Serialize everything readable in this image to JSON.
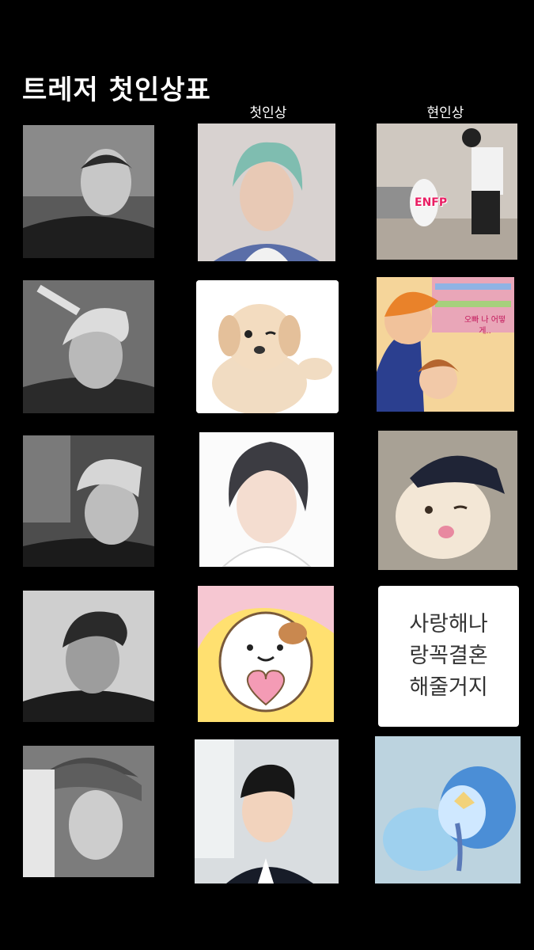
{
  "title": "트레저 첫인상표",
  "columns": [
    "",
    "첫인상",
    "현인상"
  ],
  "rows": [
    {
      "member": "monochrome-portrait-1",
      "first": "teal-hair-portrait",
      "current": "dog-and-person-photo",
      "current_caption": "ENFP"
    },
    {
      "member": "monochrome-portrait-2",
      "first": "puppy-photo",
      "current": "anime-couple-illustration",
      "current_caption": "오빠 나 어떻게.."
    },
    {
      "member": "monochrome-portrait-3",
      "first": "anime-boy-illustration",
      "current": "cat-in-cap-photo"
    },
    {
      "member": "monochrome-portrait-4",
      "first": "hamster-heart-illustration",
      "current_text": [
        "사랑해나",
        "랑꼭결혼",
        "해줄거지"
      ]
    },
    {
      "member": "monochrome-portrait-5",
      "first": "suit-selfie-photo",
      "current": "crying-penguin-illustration"
    }
  ],
  "colors": {
    "background": "#000000",
    "text": "#ffffff",
    "card": "#ffffff"
  }
}
